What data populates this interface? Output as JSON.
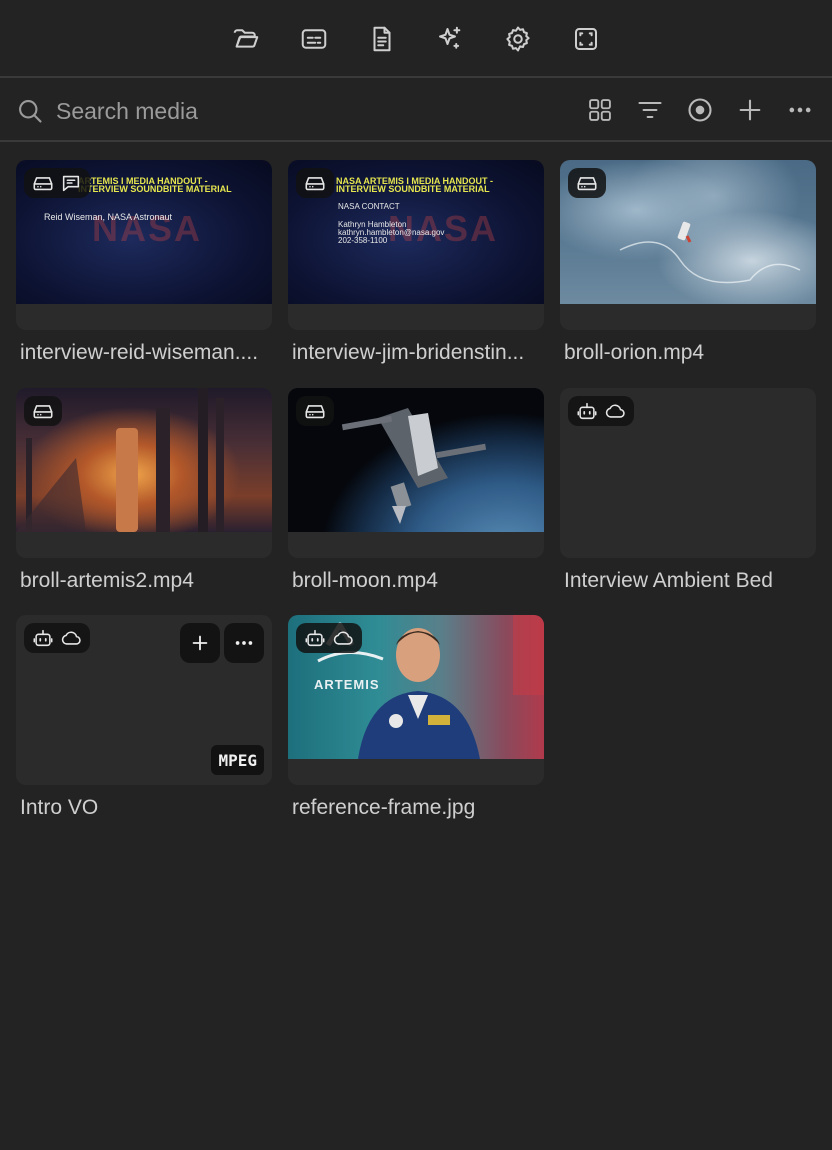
{
  "search": {
    "placeholder": "Search media"
  },
  "toolbar": {
    "icons": [
      "folder-open-icon",
      "captions-icon",
      "document-icon",
      "sparkles-icon",
      "gear-icon",
      "frame-icon"
    ]
  },
  "searchbar_actions": [
    "grid-view-icon",
    "filter-icon",
    "record-icon",
    "plus-icon",
    "more-icon"
  ],
  "media": [
    {
      "title": "interview-reid-wiseman....",
      "badges": [
        "drive",
        "caption"
      ],
      "slide": {
        "heading1": "ARTEMIS I MEDIA HANDOUT -",
        "heading2": "INTERVIEW SOUNDBITE MATERIAL",
        "body": [
          "Reid Wiseman, NASA Astronaut"
        ],
        "watermark": "NASA"
      }
    },
    {
      "title": "interview-jim-bridenstin...",
      "badges": [
        "drive"
      ],
      "slide": {
        "heading1": "NASA ARTEMIS I MEDIA HANDOUT -",
        "heading2": "INTERVIEW SOUNDBITE MATERIAL",
        "body": [
          "NASA CONTACT",
          "Kathryn Hambleton",
          "kathryn.hambleton@nasa.gov",
          "202-358-1100"
        ],
        "watermark": "NASA"
      }
    },
    {
      "title": "broll-orion.mp4",
      "badges": [
        "drive"
      ]
    },
    {
      "title": "broll-artemis2.mp4",
      "badges": [
        "drive"
      ]
    },
    {
      "title": "broll-moon.mp4",
      "badges": [
        "drive"
      ]
    },
    {
      "title": "Interview Ambient Bed",
      "badges": [
        "bot",
        "cloud"
      ]
    },
    {
      "title": "Intro VO",
      "badges": [
        "bot",
        "cloud"
      ],
      "format": "MPEG"
    },
    {
      "title": "reference-frame.jpg",
      "badges": [
        "bot",
        "cloud"
      ],
      "logo": "ARTEMIS"
    }
  ],
  "colors": {
    "background": "#232323",
    "divider": "#3a3a3a",
    "text": "#cfcfcf"
  }
}
